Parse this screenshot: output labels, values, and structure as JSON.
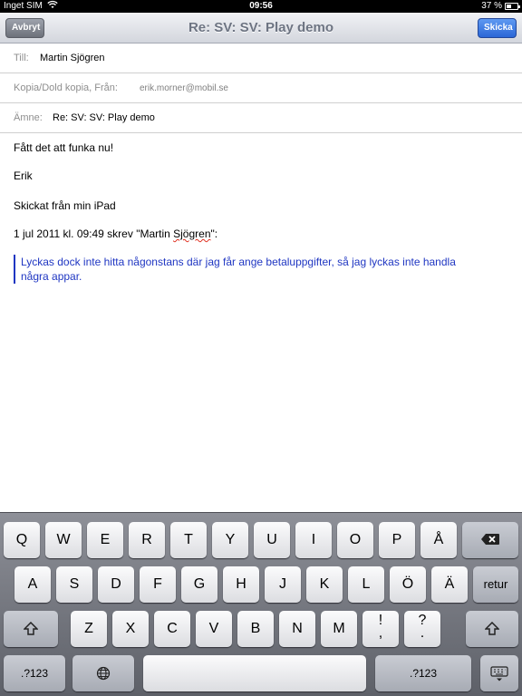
{
  "status_bar": {
    "carrier": "Inget SIM",
    "time": "09:56",
    "battery": "37 %"
  },
  "nav": {
    "title": "Re: SV: SV:  Play demo",
    "cancel_label": "Avbryt",
    "send_label": "Skicka"
  },
  "fields": {
    "to_label": "Till:",
    "to_value": "Martin Sjögren",
    "cc_label": "Kopia/Dold kopia, Från:",
    "cc_value": "erik.morner@mobil.se",
    "subject_label": "Ämne:",
    "subject_value": "Re: SV: SV:  Play demo"
  },
  "message": {
    "line1": "Fått det att funka nu!",
    "line2": "Erik",
    "line3": "Skickat från min iPad",
    "quote_header_pre": "1 jul 2011 kl. 09:49 skrev \"Martin ",
    "quote_header_name": "Sjögren",
    "quote_header_post": "\":",
    "quote_line1": "Lyckas dock inte hitta någonstans där jag får ange betaluppgifter, så jag lyckas inte handla",
    "quote_line2": "några appar."
  },
  "keyboard": {
    "row1": [
      "Q",
      "W",
      "E",
      "R",
      "T",
      "Y",
      "U",
      "I",
      "O",
      "P",
      "Å"
    ],
    "row2": [
      "A",
      "S",
      "D",
      "F",
      "G",
      "H",
      "J",
      "K",
      "L",
      "Ö",
      "Ä"
    ],
    "return_label": "retur",
    "row3": [
      "Z",
      "X",
      "C",
      "V",
      "B",
      "N",
      "M"
    ],
    "punct1_top": "!",
    "punct1_bottom": ",",
    "punct2_top": "?",
    "punct2_bottom": ".",
    "numbers_label": ".?123",
    "icons": [
      "delete-icon",
      "shift-icon",
      "globe-icon",
      "hide-keyboard-icon"
    ]
  }
}
